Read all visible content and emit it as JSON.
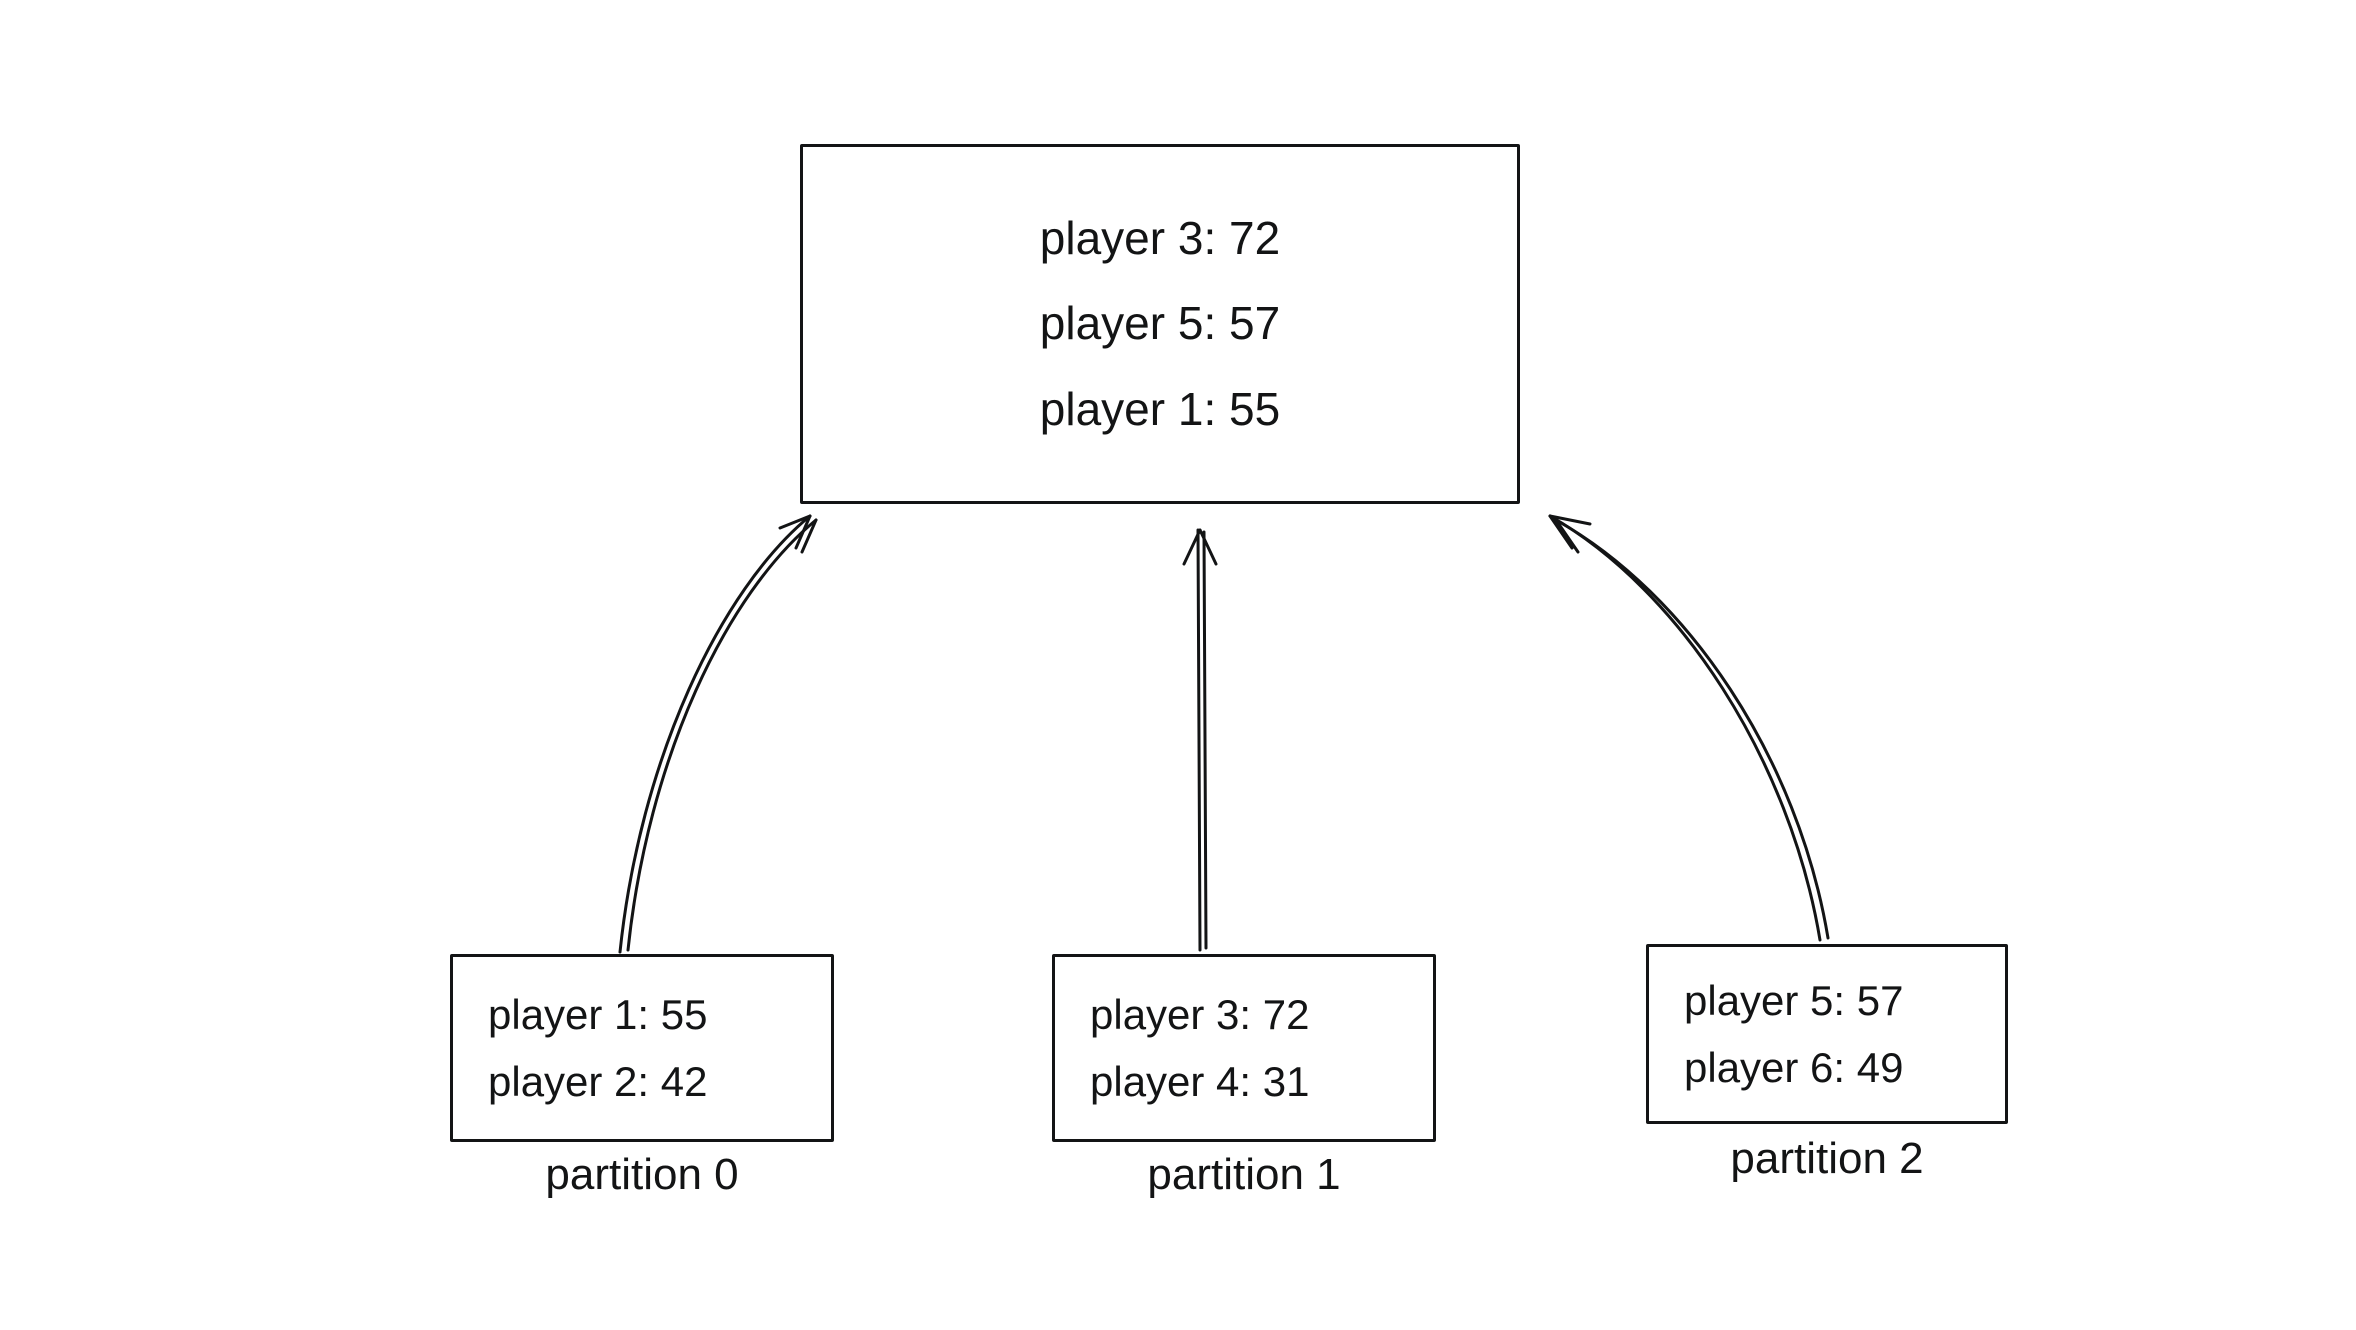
{
  "aggregator": {
    "rows": [
      {
        "text": "player 3: 72"
      },
      {
        "text": "player 5: 57"
      },
      {
        "text": "player 1: 55"
      }
    ]
  },
  "partitions": [
    {
      "label": "partition 0",
      "rows": [
        {
          "text": "player 1: 55"
        },
        {
          "text": "player 2: 42"
        }
      ]
    },
    {
      "label": "partition 1",
      "rows": [
        {
          "text": "player 3: 72"
        },
        {
          "text": "player 4: 31"
        }
      ]
    },
    {
      "label": "partition 2",
      "rows": [
        {
          "text": "player 5: 57"
        },
        {
          "text": "player 6: 49"
        }
      ]
    }
  ]
}
